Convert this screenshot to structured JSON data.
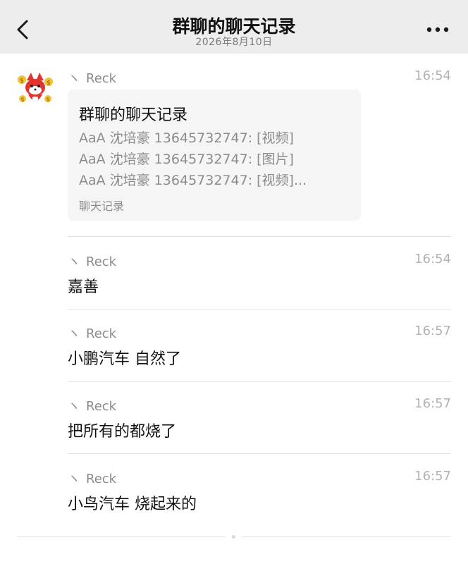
{
  "header": {
    "title": "群聊的聊天记录",
    "date": "2026年8月10日",
    "back_icon": "chevron-left-icon",
    "more_icon": "more-dots-icon"
  },
  "messages": [
    {
      "sender": "Reck",
      "time": "16:54",
      "card": {
        "title": "群聊的聊天记录",
        "lines": [
          "AaA 沈培豪 13645732747: [视频]",
          "AaA 沈培豪 13645732747: [图片]",
          "AaA 沈培豪 13645732747: [视频]..."
        ],
        "footer": "聊天记录"
      }
    },
    {
      "sender": "Reck",
      "time": "16:54",
      "text": "嘉善"
    },
    {
      "sender": "Reck",
      "time": "16:57",
      "text": "小鹏汽车 自然了"
    },
    {
      "sender": "Reck",
      "time": "16:57",
      "text": "把所有的都烧了"
    },
    {
      "sender": "Reck",
      "time": "16:57",
      "text": "小鸟汽车 烧起来的"
    }
  ],
  "colors": {
    "header_bg": "#ededed",
    "avatar_red": "#e3332e",
    "coin_gold": "#f2c230"
  }
}
